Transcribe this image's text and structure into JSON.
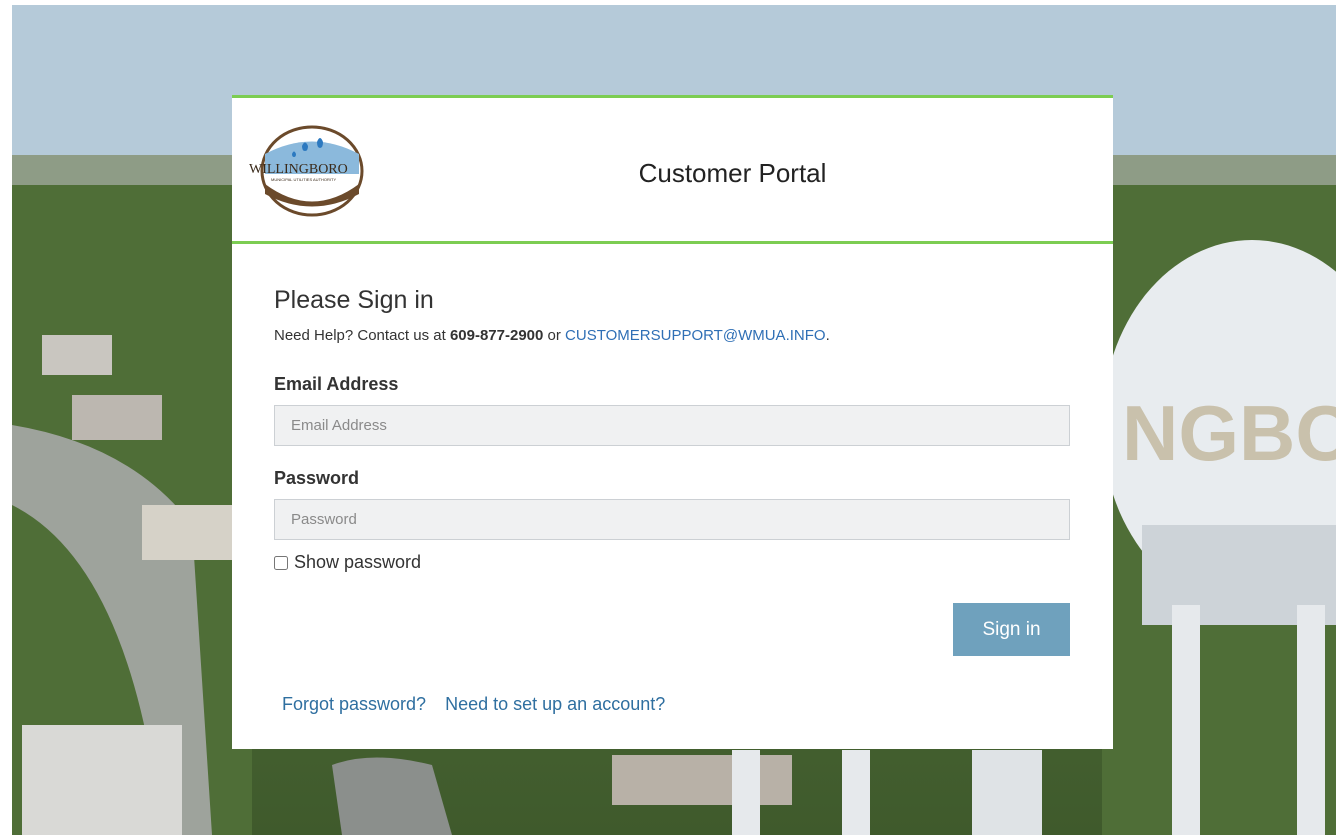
{
  "header": {
    "logo_text": "WILLINGBORO",
    "logo_subtext": "MUNICIPAL UTILITIES AUTHORITY",
    "title": "Customer Portal"
  },
  "signin": {
    "heading": "Please Sign in",
    "help_prefix": "Need Help? Contact us at ",
    "help_phone": "609-877-2900",
    "help_mid": " or ",
    "help_email": "CUSTOMERSUPPORT@WMUA.INFO",
    "help_suffix": ".",
    "email_label": "Email Address",
    "email_placeholder": "Email Address",
    "password_label": "Password",
    "password_placeholder": "Password",
    "show_password_label": "Show password",
    "submit_label": "Sign in"
  },
  "links": {
    "forgot": "Forgot password?",
    "setup": "Need to set up an account?"
  },
  "background": {
    "tower_text": "NGBO"
  },
  "colors": {
    "accent_green": "#7ccd52",
    "button": "#6fa1bd",
    "link": "#2f6fb5"
  }
}
